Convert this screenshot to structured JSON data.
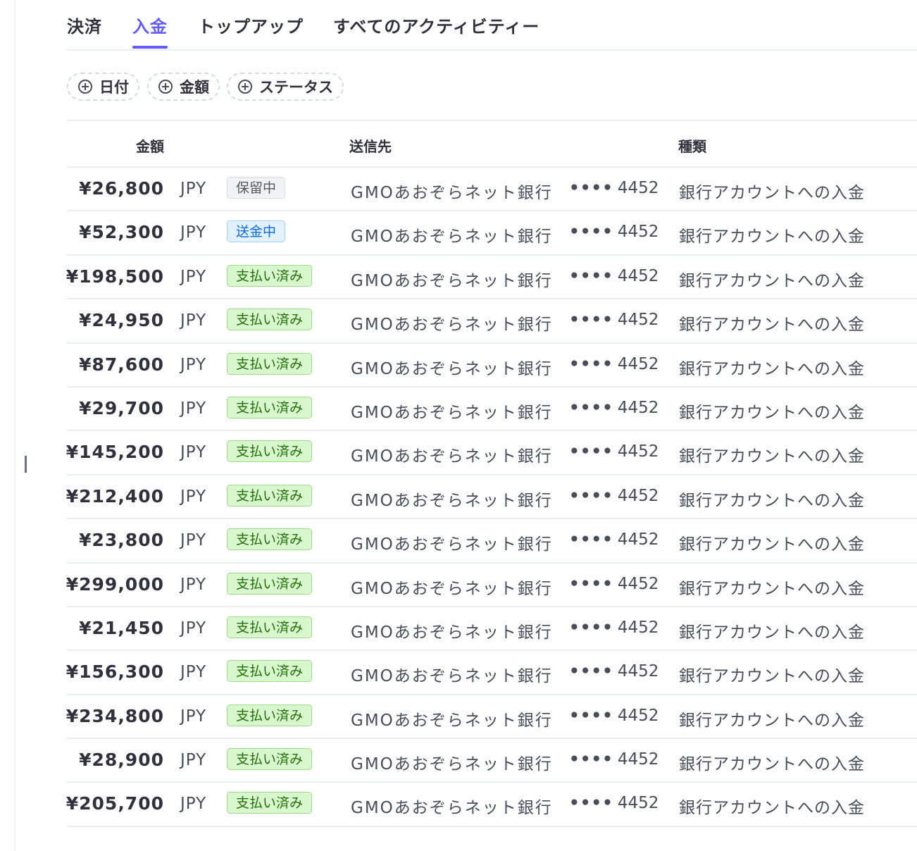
{
  "tabs": [
    {
      "label": "決済"
    },
    {
      "label": "入金",
      "active": true
    },
    {
      "label": "トップアップ"
    },
    {
      "label": "すべてのアクティビティー"
    }
  ],
  "filters": [
    {
      "label": "日付"
    },
    {
      "label": "金額"
    },
    {
      "label": "ステータス"
    }
  ],
  "table": {
    "headers": {
      "amount": "金額",
      "destination": "送信先",
      "type": "種類"
    },
    "rows": [
      {
        "amount": "¥26,800",
        "currency": "JPY",
        "status": "保留中",
        "status_kind": "gray",
        "destination": "GMOあおぞらネット銀行",
        "mask": "••••",
        "last4": "4452",
        "type": "銀行アカウントへの入金"
      },
      {
        "amount": "¥52,300",
        "currency": "JPY",
        "status": "送金中",
        "status_kind": "blue",
        "destination": "GMOあおぞらネット銀行",
        "mask": "••••",
        "last4": "4452",
        "type": "銀行アカウントへの入金"
      },
      {
        "amount": "¥198,500",
        "currency": "JPY",
        "status": "支払い済み",
        "status_kind": "green",
        "destination": "GMOあおぞらネット銀行",
        "mask": "••••",
        "last4": "4452",
        "type": "銀行アカウントへの入金"
      },
      {
        "amount": "¥24,950",
        "currency": "JPY",
        "status": "支払い済み",
        "status_kind": "green",
        "destination": "GMOあおぞらネット銀行",
        "mask": "••••",
        "last4": "4452",
        "type": "銀行アカウントへの入金"
      },
      {
        "amount": "¥87,600",
        "currency": "JPY",
        "status": "支払い済み",
        "status_kind": "green",
        "destination": "GMOあおぞらネット銀行",
        "mask": "••••",
        "last4": "4452",
        "type": "銀行アカウントへの入金"
      },
      {
        "amount": "¥29,700",
        "currency": "JPY",
        "status": "支払い済み",
        "status_kind": "green",
        "destination": "GMOあおぞらネット銀行",
        "mask": "••••",
        "last4": "4452",
        "type": "銀行アカウントへの入金"
      },
      {
        "amount": "¥145,200",
        "currency": "JPY",
        "status": "支払い済み",
        "status_kind": "green",
        "destination": "GMOあおぞらネット銀行",
        "mask": "••••",
        "last4": "4452",
        "type": "銀行アカウントへの入金"
      },
      {
        "amount": "¥212,400",
        "currency": "JPY",
        "status": "支払い済み",
        "status_kind": "green",
        "destination": "GMOあおぞらネット銀行",
        "mask": "••••",
        "last4": "4452",
        "type": "銀行アカウントへの入金"
      },
      {
        "amount": "¥23,800",
        "currency": "JPY",
        "status": "支払い済み",
        "status_kind": "green",
        "destination": "GMOあおぞらネット銀行",
        "mask": "••••",
        "last4": "4452",
        "type": "銀行アカウントへの入金"
      },
      {
        "amount": "¥299,000",
        "currency": "JPY",
        "status": "支払い済み",
        "status_kind": "green",
        "destination": "GMOあおぞらネット銀行",
        "mask": "••••",
        "last4": "4452",
        "type": "銀行アカウントへの入金"
      },
      {
        "amount": "¥21,450",
        "currency": "JPY",
        "status": "支払い済み",
        "status_kind": "green",
        "destination": "GMOあおぞらネット銀行",
        "mask": "••••",
        "last4": "4452",
        "type": "銀行アカウントへの入金"
      },
      {
        "amount": "¥156,300",
        "currency": "JPY",
        "status": "支払い済み",
        "status_kind": "green",
        "destination": "GMOあおぞらネット銀行",
        "mask": "••••",
        "last4": "4452",
        "type": "銀行アカウントへの入金"
      },
      {
        "amount": "¥234,800",
        "currency": "JPY",
        "status": "支払い済み",
        "status_kind": "green",
        "destination": "GMOあおぞらネット銀行",
        "mask": "••••",
        "last4": "4452",
        "type": "銀行アカウントへの入金"
      },
      {
        "amount": "¥28,900",
        "currency": "JPY",
        "status": "支払い済み",
        "status_kind": "green",
        "destination": "GMOあおぞらネット銀行",
        "mask": "••••",
        "last4": "4452",
        "type": "銀行アカウントへの入金"
      },
      {
        "amount": "¥205,700",
        "currency": "JPY",
        "status": "支払い済み",
        "status_kind": "green",
        "destination": "GMOあおぞらネット銀行",
        "mask": "••••",
        "last4": "4452",
        "type": "銀行アカウントへの入金"
      }
    ]
  },
  "colors": {
    "accent": "#635bff",
    "status_green": "#217005",
    "status_blue": "#0f6ad9",
    "status_gray": "#50575f"
  },
  "icons": {
    "filter_chip": "plus-circle-icon"
  }
}
